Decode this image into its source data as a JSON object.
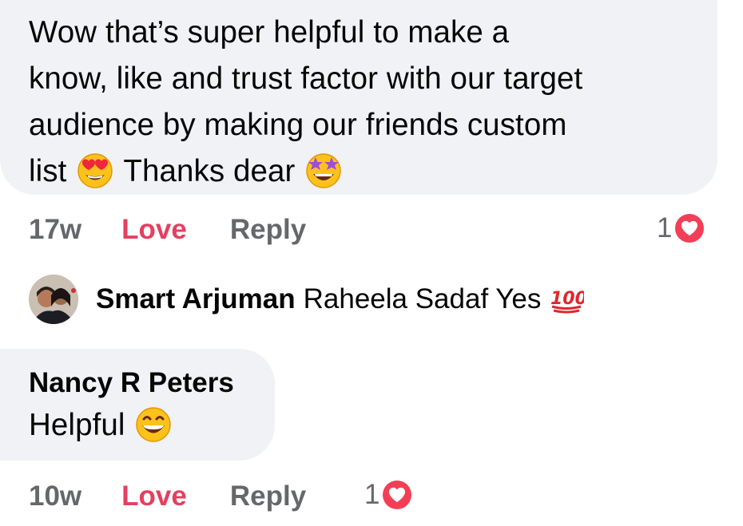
{
  "comment1": {
    "lines": [
      "Wow that’s super helpful to make a",
      "know, like and trust factor with our target",
      "audience by making our friends custom"
    ],
    "last_line_part1": "list",
    "last_line_part2": "Thanks dear",
    "emoji1": "heart-eyes-emoji",
    "emoji2": "star-struck-emoji",
    "time": "17w",
    "love_label": "Love",
    "reply_label": "Reply",
    "reaction_count": "1",
    "reaction_icon": "heart-icon"
  },
  "reply1": {
    "author": "Smart Arjuman",
    "text": "Raheela Sadaf Yes",
    "emoji": "hundred-points-emoji"
  },
  "comment2": {
    "author": "Nancy R Peters",
    "text": "Helpful",
    "emoji": "grinning-emoji",
    "time": "10w",
    "love_label": "Love",
    "reply_label": "Reply",
    "reaction_count": "1",
    "reaction_icon": "heart-icon"
  },
  "colors": {
    "bubble": "#f0f2f5",
    "love": "#e4405f",
    "meta": "#65676b",
    "heart_badge": "#f33e58"
  }
}
